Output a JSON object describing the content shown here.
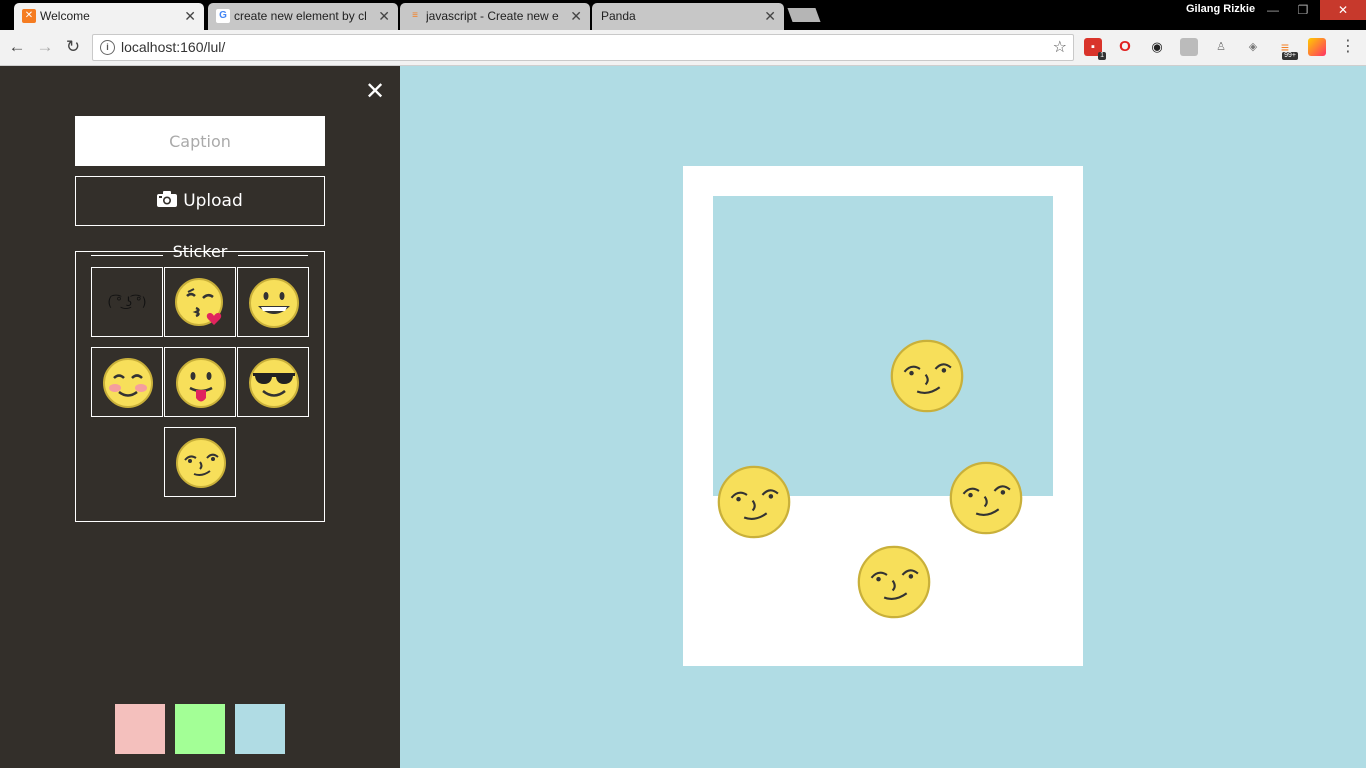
{
  "browser": {
    "tabs": [
      {
        "title": "Welcome",
        "favicon": "xampp-icon",
        "color": "#f57c21",
        "active": true
      },
      {
        "title": "create new element by cl",
        "favicon": "google-icon",
        "color": "#4285f4",
        "active": false
      },
      {
        "title": "javascript - Create new e",
        "favicon": "stackoverflow-icon",
        "color": "#f48024",
        "active": false
      },
      {
        "title": "Panda",
        "favicon": "",
        "color": "",
        "active": false
      }
    ],
    "profile_name": "Gilang Rizkie",
    "url": "localhost:160/lul/",
    "extension_badges": {
      "first": "1",
      "stack": "99+"
    }
  },
  "sidebar": {
    "caption_placeholder": "Caption",
    "caption_value": "",
    "upload_label": "Upload",
    "sticker_label": "Sticker",
    "stickers": [
      {
        "name": "lenny-face",
        "text": "( ͡° ͜ʖ ͡°)"
      },
      {
        "name": "kissing-heart-emoji"
      },
      {
        "name": "grinning-emoji"
      },
      {
        "name": "blushing-emoji"
      },
      {
        "name": "tongue-out-emoji"
      },
      {
        "name": "sunglasses-emoji"
      },
      {
        "name": "smirk-emoji"
      }
    ],
    "swatches": [
      {
        "name": "pink",
        "color": "#f4c0bd"
      },
      {
        "name": "green",
        "color": "#a3ff96"
      },
      {
        "name": "light-blue",
        "color": "#b0dce4"
      }
    ]
  },
  "canvas": {
    "background": "#b0dce4",
    "polaroid_color": "#ffffff",
    "placed_sticker_type": "smirk-emoji",
    "placed_sticker_count": 4
  }
}
